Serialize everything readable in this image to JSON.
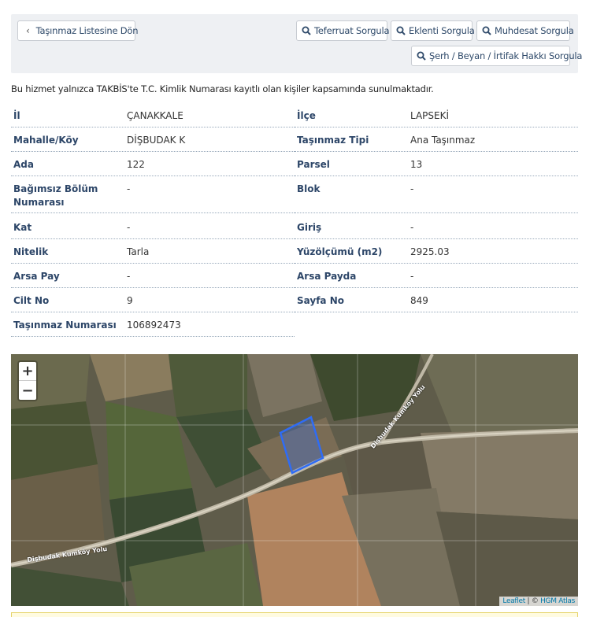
{
  "toolbar": {
    "back_label": "Taşınmaz Listesine Dön",
    "teferruat_label": "Teferruat Sorgula",
    "eklenti_label": "Eklenti Sorgula",
    "muhdesat_label": "Muhdesat Sorgula",
    "serh_label": "Şerh / Beyan / İrtifak Hakkı Sorgula"
  },
  "notice": "Bu hizmet yalnızca TAKBİS'te T.C. Kimlik Numarası kayıtlı olan kişiler kapsamında sunulmaktadır.",
  "fields": {
    "il": {
      "label": "İl",
      "value": "ÇANAKKALE"
    },
    "ilce": {
      "label": "İlçe",
      "value": "LAPSEKİ"
    },
    "mahalle": {
      "label": "Mahalle/Köy",
      "value": "DİŞBUDAK K"
    },
    "tip": {
      "label": "Taşınmaz Tipi",
      "value": "Ana Taşınmaz"
    },
    "ada": {
      "label": "Ada",
      "value": "122"
    },
    "parsel": {
      "label": "Parsel",
      "value": "13"
    },
    "bagimsiz": {
      "label": "Bağımsız Bölüm Numarası",
      "value": "-"
    },
    "blok": {
      "label": "Blok",
      "value": "-"
    },
    "kat": {
      "label": "Kat",
      "value": "-"
    },
    "giris": {
      "label": "Giriş",
      "value": "-"
    },
    "nitelik": {
      "label": "Nitelik",
      "value": "Tarla"
    },
    "yuzolcumu": {
      "label": "Yüzölçümü (m2)",
      "value": "2925.03"
    },
    "arsa_pay": {
      "label": "Arsa Pay",
      "value": "-"
    },
    "arsa_payda": {
      "label": "Arsa Payda",
      "value": "-"
    },
    "cilt": {
      "label": "Cilt No",
      "value": "9"
    },
    "sayfa": {
      "label": "Sayfa No",
      "value": "849"
    },
    "numara": {
      "label": "Taşınmaz Numarası",
      "value": "106892473"
    }
  },
  "map": {
    "zoom_in": "+",
    "zoom_out": "−",
    "attribution_leaflet": "Leaflet",
    "attribution_sep": " | © ",
    "attribution_source": "HGM Atlas",
    "road_label_1": "Dişbudak Kumköy Yolu",
    "road_label_2": "Dişbudak Kumköy Yolu",
    "parcel_color": "#2f6cf5"
  }
}
